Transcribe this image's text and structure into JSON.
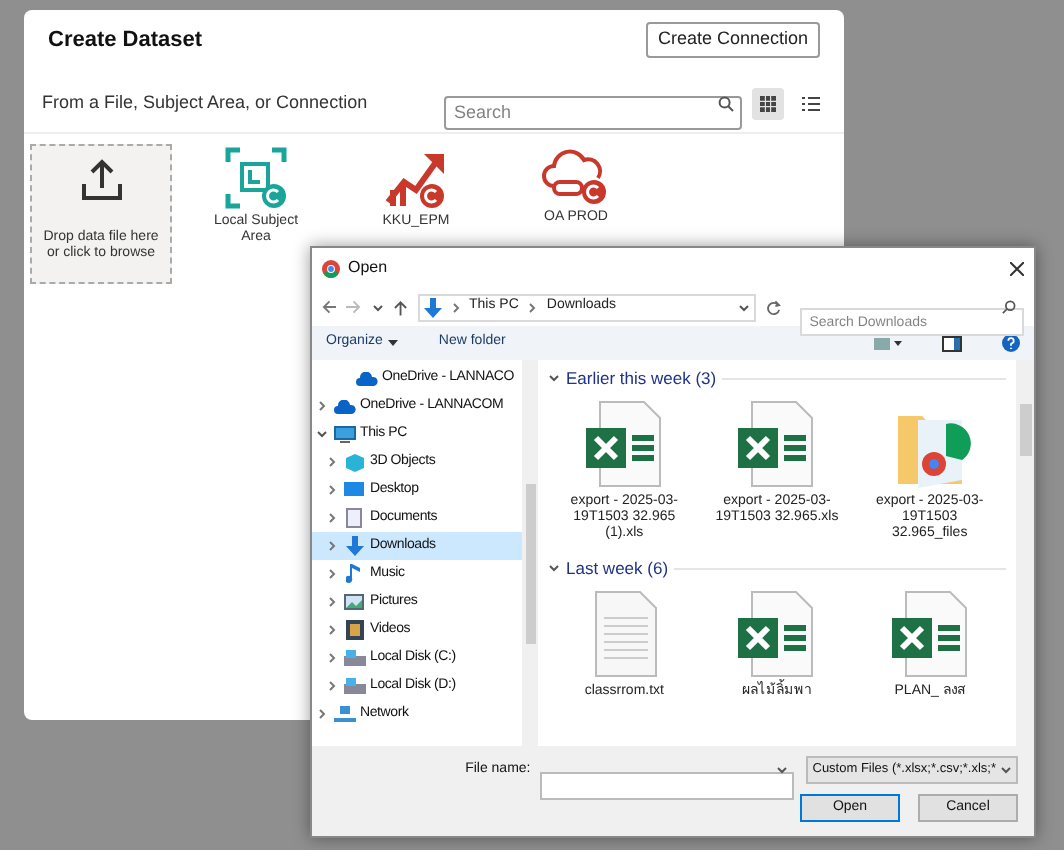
{
  "panel": {
    "title": "Create Dataset",
    "create_button": "Create Connection",
    "subtitle": "From a File, Subject Area, or Connection",
    "search": {
      "placeholder": "Search"
    },
    "views": [
      {
        "kind": "grid",
        "selected": true
      },
      {
        "kind": "list",
        "selected": false
      }
    ],
    "sources": [
      {
        "kind": "upload",
        "label": "Drop data file here or click to browse"
      },
      {
        "kind": "subject-area",
        "label": "Local Subject Area"
      },
      {
        "kind": "chart",
        "label": "KKU_EPM"
      },
      {
        "kind": "cloud",
        "label": "OA PROD"
      }
    ]
  },
  "dialog": {
    "title": "Open",
    "path": [
      "This PC",
      "Downloads"
    ],
    "search": {
      "placeholder": "Search Downloads"
    },
    "toolbar": [
      "Organize",
      "New folder"
    ],
    "nav": [
      {
        "label": "OneDrive - LANNACO",
        "kind": "cloud"
      },
      {
        "label": "OneDrive - LANNACOM",
        "kind": "cloud",
        "expanded": false
      },
      {
        "label": "This PC",
        "kind": "pc",
        "expanded": true,
        "children": [
          {
            "label": "3D Objects",
            "kind": "cube",
            "expanded": false,
            "selected": false
          },
          {
            "label": "Desktop",
            "kind": "desktop",
            "expanded": false,
            "selected": false
          },
          {
            "label": "Documents",
            "kind": "doc",
            "expanded": false,
            "selected": false
          },
          {
            "label": "Downloads",
            "kind": "download",
            "expanded": false,
            "selected": true
          },
          {
            "label": "Music",
            "kind": "music",
            "expanded": false,
            "selected": false
          },
          {
            "label": "Pictures",
            "kind": "picture",
            "expanded": false,
            "selected": false
          },
          {
            "label": "Videos",
            "kind": "video",
            "expanded": false,
            "selected": false
          },
          {
            "label": "Local Disk (C:)",
            "kind": "disk",
            "expanded": false,
            "selected": false
          },
          {
            "label": "Local Disk (D:)",
            "kind": "disk",
            "expanded": false,
            "selected": false
          }
        ]
      },
      {
        "label": "Network",
        "kind": "network",
        "expanded": false
      }
    ],
    "groups": [
      {
        "label": "Earlier this week (3)",
        "expanded": true,
        "files": [
          {
            "name": "export - 2025-03-19T1503 32.965 (1).xls",
            "kind": "excel"
          },
          {
            "name": "export - 2025-03-19T1503 32.965.xls",
            "kind": "excel"
          },
          {
            "name": "export - 2025-03-19T1503 32.965_files",
            "kind": "folder"
          }
        ]
      },
      {
        "label": "Last week (6)",
        "expanded": true,
        "files": [
          {
            "name": "classrrom.txt",
            "kind": "text"
          },
          {
            "name": "ผลไม้ลิ้มพา",
            "kind": "excel"
          },
          {
            "name": "PLAN_ ลงส",
            "kind": "excel"
          }
        ]
      }
    ],
    "file_name": {
      "label": "File name:"
    },
    "filter": "Custom Files (*.xlsx;*.csv;*.xls;*",
    "buttons": [
      {
        "label": "Open",
        "kind": "primary"
      },
      {
        "label": "Cancel",
        "kind": "normal"
      }
    ]
  }
}
